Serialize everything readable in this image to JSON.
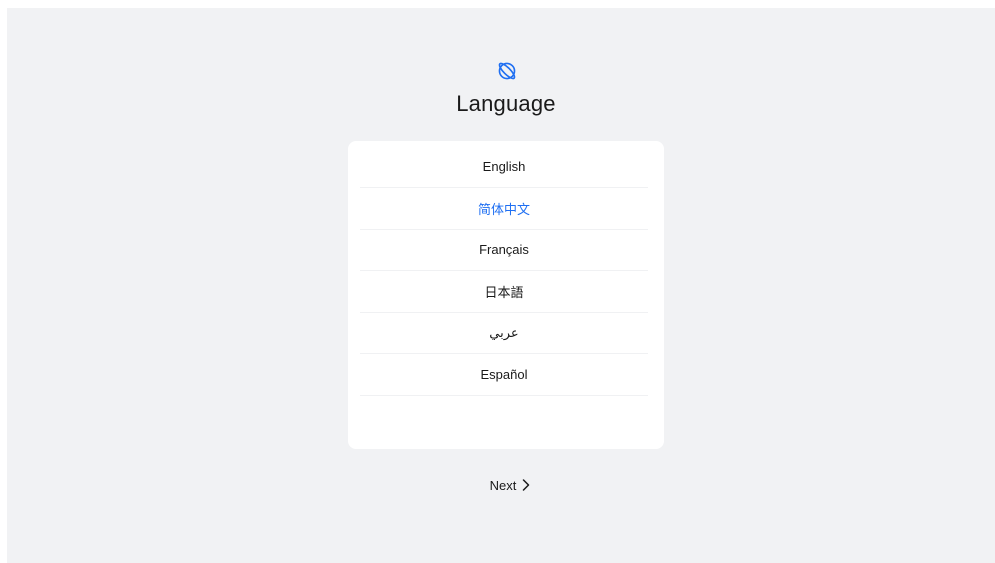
{
  "header": {
    "icon": "globe-icon",
    "title": "Language"
  },
  "languages": [
    {
      "label": "English",
      "selected": false
    },
    {
      "label": "简体中文",
      "selected": true
    },
    {
      "label": "Français",
      "selected": false
    },
    {
      "label": "日本語",
      "selected": false
    },
    {
      "label": "عربي",
      "selected": false
    },
    {
      "label": "Español",
      "selected": false
    }
  ],
  "footer": {
    "next_label": "Next",
    "next_icon": "chevron-right-icon"
  },
  "colors": {
    "accent": "#1f6ff2",
    "background": "#f1f2f4",
    "card": "#ffffff",
    "text": "#1a1a1a"
  }
}
